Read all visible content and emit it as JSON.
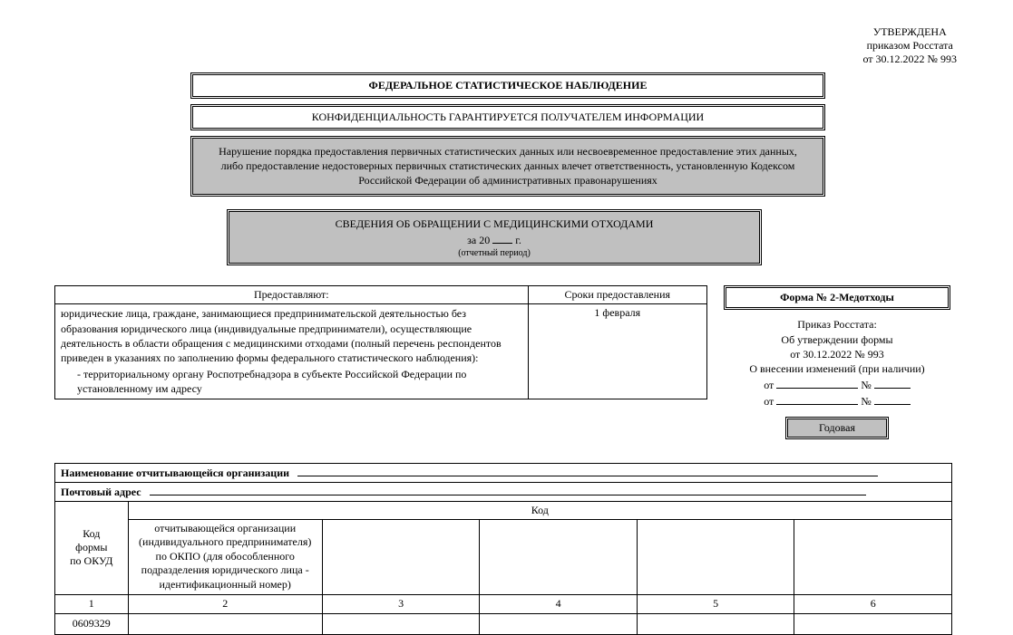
{
  "approved": {
    "line1": "УТВЕРЖДЕНА",
    "line2": "приказом Росстата",
    "line3": "от 30.12.2022 № 993"
  },
  "header": {
    "title1": "ФЕДЕРАЛЬНОЕ СТАТИСТИЧЕСКОЕ НАБЛЮДЕНИЕ",
    "title2": "КОНФИДЕНЦИАЛЬНОСТЬ ГАРАНТИРУЕТСЯ ПОЛУЧАТЕЛЕМ ИНФОРМАЦИИ",
    "warning": "Нарушение порядка предоставления первичных статистических данных или несвоевременное предоставление этих данных, либо предоставление недостоверных первичных статистических данных влечет ответственность, установленную Кодексом Российской Федерации об административных правонарушениях"
  },
  "info": {
    "title": "СВЕДЕНИЯ ОБ ОБРАЩЕНИИ С МЕДИЦИНСКИМИ ОТХОДАМИ",
    "year_prefix": "за 20",
    "year_suffix": "г.",
    "period_note": "(отчетный период)"
  },
  "provide": {
    "col1_header": "Предоставляют:",
    "col2_header": "Сроки предоставления",
    "body": "юридические лица, граждане, занимающиеся предпринимательской деятельностью без образования юридического лица (индивидуальные предприниматели), осуществляющие деятельность в области обращения с медицинскими отходами (полный перечень респондентов приведен в указаниях по заполнению формы федерального статистического наблюдения):",
    "sub": "- территориальному органу Роспотребнадзора в субъекте Российской Федерации по установленному им адресу",
    "deadline": "1 февраля"
  },
  "form": {
    "name": "Форма № 2-Медотходы",
    "order_line1": "Приказ Росстата:",
    "order_line2": "Об утверждении формы",
    "order_line3": "от 30.12.2022 № 993",
    "changes": "О внесении изменений (при наличии)",
    "ot": "от",
    "num": "№",
    "annual": "Годовая"
  },
  "codes": {
    "org_label": "Наименование отчитывающейся организации",
    "addr_label": "Почтовый адрес",
    "okud_label_1": "Код",
    "okud_label_2": "формы",
    "okud_label_3": "по ОКУД",
    "code_header": "Код",
    "okpo_desc": "отчитывающейся организации (индивиду­ального предпринимателя) по ОКПО (для обособленного подразделения юридического лица - идентификационный номер)",
    "cols": [
      "1",
      "2",
      "3",
      "4",
      "5",
      "6"
    ],
    "okud_value": "0609329"
  }
}
